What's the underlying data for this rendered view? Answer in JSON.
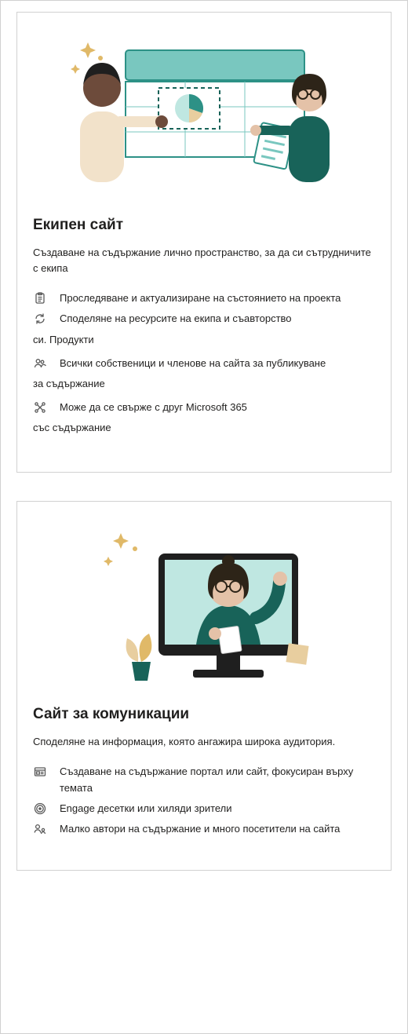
{
  "cards": [
    {
      "title": "Екипен сайт",
      "description": "Създаване на съдържание лично пространство, за да си сътрудничите с екипа",
      "features": [
        {
          "icon": "clipboard",
          "text": "Проследяване и актуализиране на състоянието на проекта",
          "cont": ""
        },
        {
          "icon": "cycle",
          "text": "Споделяне на ресурсите на екипа и съавторство",
          "cont": "си. Продукти"
        },
        {
          "icon": "people",
          "text": "Всички собственици и членове на сайта за публикуване",
          "cont": "за съдържание"
        },
        {
          "icon": "connect",
          "text": "Може да се свърже с друг Microsoft 365",
          "cont": "със съдържание"
        }
      ]
    },
    {
      "title": "Сайт за комуникации",
      "description": "Споделяне на информация, която ангажира широка аудитория.",
      "features": [
        {
          "icon": "newspaper",
          "text": "Създаване на съдържание портал или сайт, фокусиран върху темата",
          "cont": ""
        },
        {
          "icon": "broadcast",
          "text": "Engage десетки или хиляди зрители",
          "cont": ""
        },
        {
          "icon": "authors",
          "text": "Малко автори на съдържание и много посетители на сайта",
          "cont": ""
        }
      ]
    }
  ]
}
